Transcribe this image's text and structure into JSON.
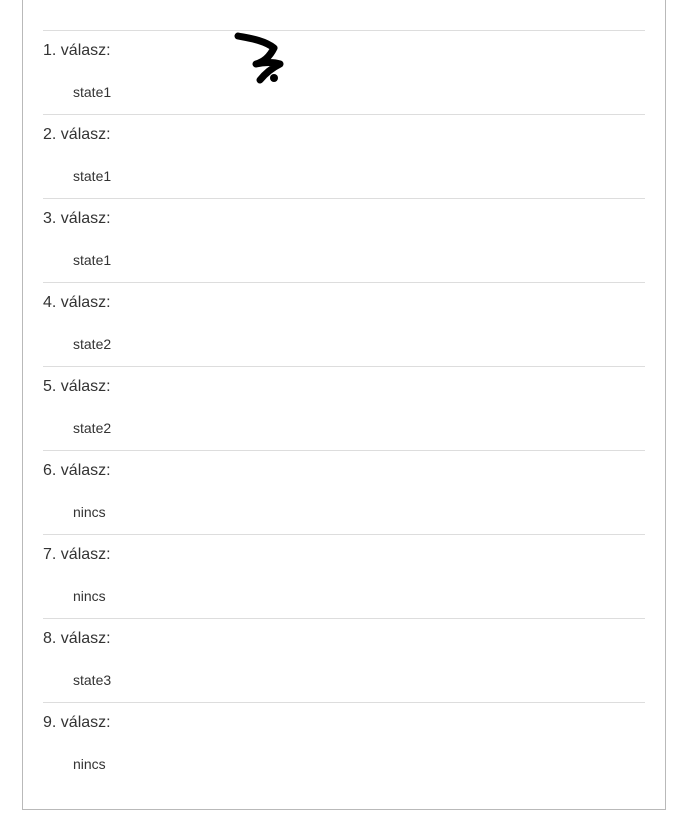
{
  "answers": [
    {
      "label": "1. válasz:",
      "value": "state1"
    },
    {
      "label": "2. válasz:",
      "value": "state1"
    },
    {
      "label": "3. válasz:",
      "value": "state1"
    },
    {
      "label": "4. válasz:",
      "value": "state2"
    },
    {
      "label": "5. válasz:",
      "value": "state2"
    },
    {
      "label": "6. válasz:",
      "value": "nincs"
    },
    {
      "label": "7. válasz:",
      "value": "nincs"
    },
    {
      "label": "8. válasz:",
      "value": "state3"
    },
    {
      "label": "9. válasz:",
      "value": "nincs"
    }
  ]
}
